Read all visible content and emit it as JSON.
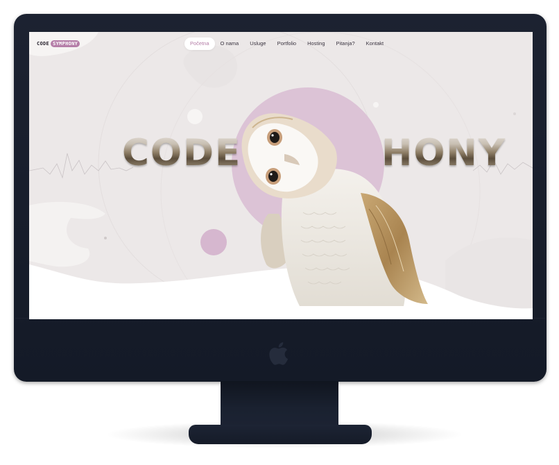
{
  "site": {
    "logo": {
      "code": "CODE",
      "symphony": "SYMPHONY"
    },
    "nav": [
      {
        "label": "Početna",
        "active": true
      },
      {
        "label": "O nama",
        "active": false
      },
      {
        "label": "Usluge",
        "active": false
      },
      {
        "label": "Portfolio",
        "active": false
      },
      {
        "label": "Hosting",
        "active": false
      },
      {
        "label": "Pitanja?",
        "active": false
      },
      {
        "label": "Kontakt",
        "active": false
      }
    ],
    "hero": {
      "left_text": "CODE",
      "right_text": "HONY"
    }
  },
  "colors": {
    "accent": "#b57ea8",
    "screen_bg": "#ece8e8",
    "monitor": "#161c29"
  },
  "icons": [
    "apple-logo-icon"
  ]
}
